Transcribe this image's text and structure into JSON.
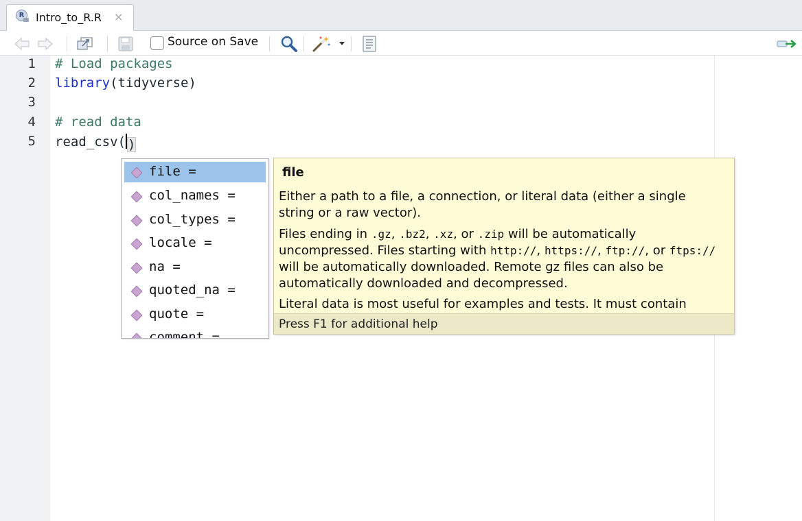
{
  "tab": {
    "title": "Intro_to_R.R",
    "close_glyph": "×",
    "badge": "R"
  },
  "toolbar": {
    "source_on_save_label": "Source on Save",
    "icons": [
      "back-arrow-icon",
      "forward-arrow-icon",
      "show-in-window-icon",
      "save-icon",
      "search-icon",
      "magic-wand-icon",
      "dropdown-arrow-icon",
      "compile-report-icon",
      "run-icon"
    ]
  },
  "editor": {
    "lines": [
      {
        "num": "1",
        "text": "# Load packages"
      },
      {
        "num": "2",
        "fn": "library",
        "args": "(tidyverse)"
      },
      {
        "num": "3",
        "text": ""
      },
      {
        "num": "4",
        "text": "# read data"
      },
      {
        "num": "5",
        "fn": "read_csv",
        "args_open": "(",
        "args_close": ")"
      }
    ]
  },
  "completion": {
    "items": [
      "file =",
      "col_names =",
      "col_types =",
      "locale =",
      "na =",
      "quoted_na =",
      "quote =",
      "comment ="
    ],
    "selected_index": 0
  },
  "help": {
    "title": "file",
    "para1": "Either a path to a file, a connection, or literal data (either a single string or a raw vector).",
    "para2_parts": [
      "Files ending in ",
      ".gz",
      ", ",
      ".bz2",
      ", ",
      ".xz",
      ", or ",
      ".zip",
      " will be automatically uncompressed. Files starting with ",
      "http://",
      ", ",
      "https://",
      ", ",
      "ftp://",
      ", or ",
      "ftps://",
      " will be automatically downloaded. Remote gz files can also be automatically downloaded and decompressed."
    ],
    "para3": "Literal data is most useful for examples and tests. It must contain",
    "footer": "Press F1 for additional help"
  },
  "colors": {
    "comment": "#3d7a67",
    "function": "#1f33cc",
    "selected_item": "#9cc4ea",
    "tooltip_bg": "#fefcd6"
  }
}
